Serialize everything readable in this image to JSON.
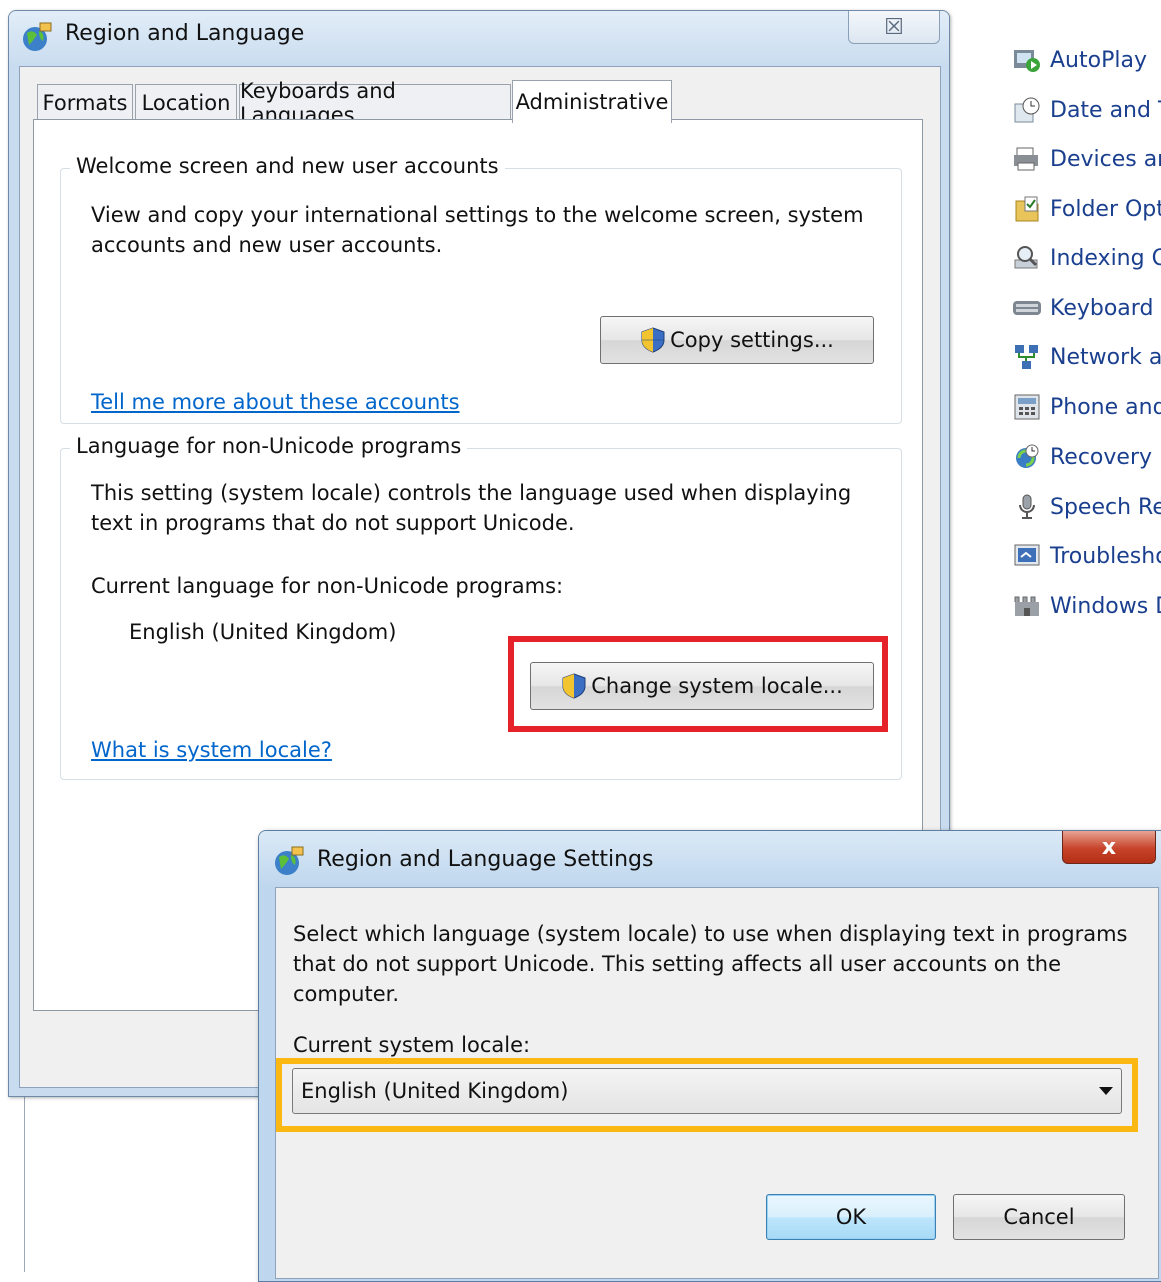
{
  "control_panel": {
    "items": [
      {
        "label": "AutoPlay",
        "icon": "autoplay-icon"
      },
      {
        "label": "Date and T",
        "icon": "date-time-icon"
      },
      {
        "label": "Devices an",
        "icon": "devices-printers-icon"
      },
      {
        "label": "Folder Opt",
        "icon": "folder-options-icon"
      },
      {
        "label": "Indexing O",
        "icon": "indexing-options-icon"
      },
      {
        "label": "Keyboard",
        "icon": "keyboard-icon"
      },
      {
        "label": "Network a",
        "icon": "network-icon"
      },
      {
        "label": "Phone and",
        "icon": "phone-modem-icon"
      },
      {
        "label": "Recovery",
        "icon": "recovery-icon"
      },
      {
        "label": "Speech Re",
        "icon": "microphone-icon"
      },
      {
        "label": "Troublesho",
        "icon": "troubleshooting-icon"
      },
      {
        "label": "Windows D",
        "icon": "windows-defender-icon"
      }
    ]
  },
  "main_dialog": {
    "title": "Region and Language",
    "close_glyph": "☒",
    "tabs": [
      {
        "label": "Formats"
      },
      {
        "label": "Location"
      },
      {
        "label": "Keyboards and Languages"
      },
      {
        "label": "Administrative",
        "active": true
      }
    ],
    "welcome_group": {
      "legend": "Welcome screen and new user accounts",
      "text_line1": "View and copy your international settings to the welcome screen, system",
      "text_line2": "accounts and new user accounts.",
      "button": "Copy settings...",
      "link": "Tell me more about these accounts"
    },
    "locale_group": {
      "legend": "Language for non-Unicode programs",
      "text_line1": "This setting (system locale) controls the language used when displaying",
      "text_line2": "text in programs that do not support Unicode.",
      "current_label": "Current language for non-Unicode programs:",
      "current_value": "English (United Kingdom)",
      "button": "Change system locale...",
      "link": "What is system locale?"
    }
  },
  "settings_dialog": {
    "title": "Region and Language Settings",
    "close_glyph": "x",
    "text_line1": "Select which language (system locale) to use when displaying text in programs",
    "text_line2": "that do not support Unicode. This setting affects all user accounts on the",
    "text_line3": "computer.",
    "current_label": "Current system locale:",
    "selected_locale": "English (United Kingdom)",
    "ok": "OK",
    "cancel": "Cancel"
  },
  "colors": {
    "highlight_red": "#e5212a",
    "highlight_yellow": "#fbb813",
    "link_blue": "#0066cc"
  }
}
